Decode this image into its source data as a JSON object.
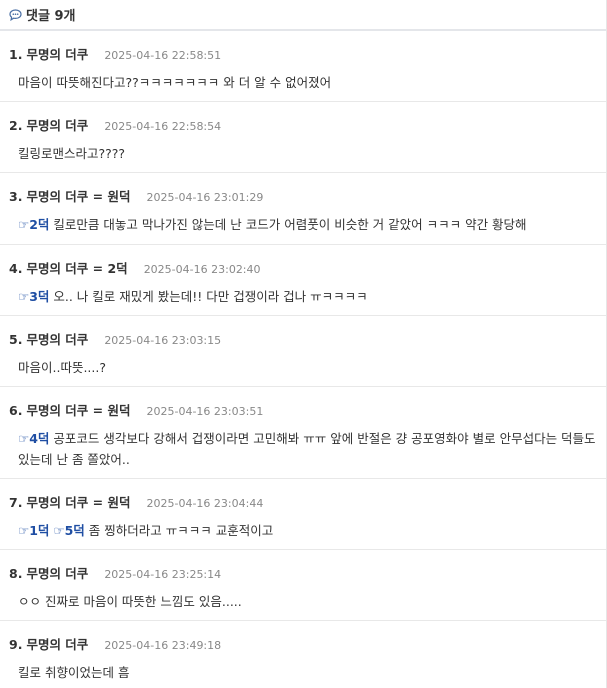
{
  "header": {
    "icon": "speech-bubble-icon",
    "label": "댓글",
    "count": "9개"
  },
  "comments": [
    {
      "num": "1.",
      "author": "무명의 더쿠",
      "date": "2025-04-16 22:58:51",
      "text": "마음이 따뜻해진다고??ㅋㅋㅋㅋㅋㅋㅋ 와 더 알 수 없어졌어"
    },
    {
      "num": "2.",
      "author": "무명의 더쿠",
      "date": "2025-04-16 22:58:54",
      "text": "킬링로맨스라고????"
    },
    {
      "num": "3.",
      "author": "무명의 더쿠 = 원덕",
      "date": "2025-04-16 23:01:29",
      "mention": "☞2덕",
      "text": " 킬로만큼 대놓고 막나가진 않는데 난 코드가 어렴풋이 비슷한 거 같았어 ㅋㅋㅋ 약간 황당해"
    },
    {
      "num": "4.",
      "author": "무명의 더쿠 = 2덕",
      "date": "2025-04-16 23:02:40",
      "mention": "☞3덕",
      "text": " 오.. 나 킬로 재밌게 봤는데!! 다만 겁쟁이라 겁나 ㅠㅋㅋㅋㅋ"
    },
    {
      "num": "5.",
      "author": "무명의 더쿠",
      "date": "2025-04-16 23:03:15",
      "text": "마음이..따뜻....?"
    },
    {
      "num": "6.",
      "author": "무명의 더쿠 = 원덕",
      "date": "2025-04-16 23:03:51",
      "mention": "☞4덕",
      "text": " 공포코드 생각보다 강해서 겁쟁이라면 고민해봐 ㅠㅠ 앞에 반절은 걍 공포영화야 별로 안무섭다는 덕들도 있는데 난 좀 쫄았어.."
    },
    {
      "num": "7.",
      "author": "무명의 더쿠 = 원덕",
      "date": "2025-04-16 23:04:44",
      "mention": "☞1덕",
      "mention2": "☞5덕",
      "text": " 좀 찡하더라고 ㅠㅋㅋㅋ 교훈적이고"
    },
    {
      "num": "8.",
      "author": "무명의 더쿠",
      "date": "2025-04-16 23:25:14",
      "text": "ㅇㅇ 진짜로 마음이 따뜻한 느낌도 있음....."
    },
    {
      "num": "9.",
      "author": "무명의 더쿠",
      "date": "2025-04-16 23:49:18",
      "text": "킬로 취향이었는데 흠"
    }
  ]
}
